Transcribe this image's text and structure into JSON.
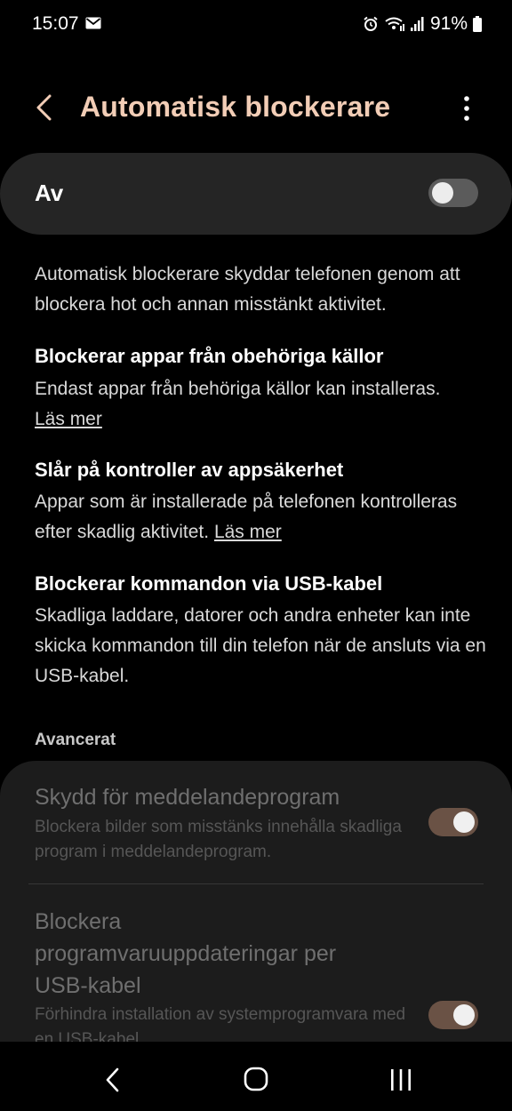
{
  "status_bar": {
    "time": "15:07",
    "battery": "91%",
    "icons": [
      "mail-icon",
      "alarm-icon",
      "wifi-call-icon",
      "signal-icon",
      "battery-icon"
    ]
  },
  "header": {
    "title": "Automatisk blockerare",
    "back_icon": "chevron-left-icon",
    "more_icon": "more-vertical-icon",
    "title_color": "#f2cdb6"
  },
  "main_toggle": {
    "label": "Av",
    "checked": false
  },
  "intro": "Automatisk blockerare skyddar telefonen genom att blockera hot och annan misstänkt aktivitet.",
  "sections": [
    {
      "title": "Blockerar appar från obehöriga källor",
      "text": "Endast appar från behöriga källor kan installeras.",
      "link": "Läs mer"
    },
    {
      "title": "Slår på kontroller av appsäkerhet",
      "text": "Appar som är installerade på telefonen kontrolleras efter skadlig aktivitet.",
      "link": "Läs mer"
    },
    {
      "title": "Blockerar kommandon via USB-kabel",
      "text": "Skadliga laddare, datorer och andra enheter kan inte skicka kommandon till din telefon när de ansluts via en USB-kabel."
    }
  ],
  "advanced": {
    "label": "Avancerat",
    "items": [
      {
        "title": "Skydd för meddelandeprogram",
        "subtitle": "Blockera bilder som misstänks innehålla skadliga program i meddelandeprogram.",
        "checked": true,
        "enabled": false
      },
      {
        "title": "Blockera programvaruuppdateringar per USB-kabel",
        "subtitle": "Förhindra installation av systemprogramvara med en USB-kabel.",
        "checked": true,
        "enabled": false
      }
    ]
  },
  "navbar": {
    "back_icon": "nav-back-icon",
    "home_icon": "nav-home-icon",
    "recent_icon": "nav-recent-apps-icon"
  },
  "colors": {
    "background": "#000000",
    "card": "#252525",
    "switch_on_track": "#6a5245"
  }
}
